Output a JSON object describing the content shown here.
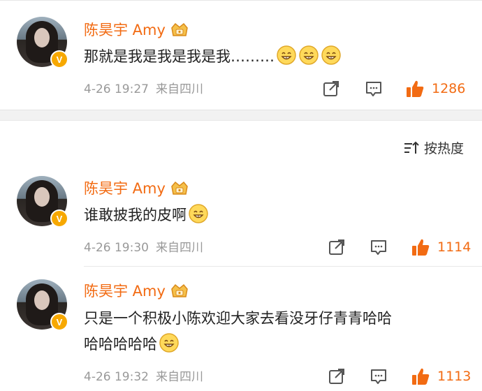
{
  "sort": {
    "label": "按热度"
  },
  "comments": [
    {
      "author": "陈昊宇 Amy",
      "text": "那就是我是我是我是我………",
      "emoji_count": 3,
      "date": "4-26 19:27",
      "location": "来自四川",
      "likes": "1286"
    },
    {
      "author": "陈昊宇 Amy",
      "text": "谁敢披我的皮啊",
      "emoji_count": 1,
      "date": "4-26 19:30",
      "location": "来自四川",
      "likes": "1114"
    },
    {
      "author": "陈昊宇 Amy",
      "text_line1": "只是一个积极小陈欢迎大家去看没牙仔青青哈哈",
      "text_line2": "哈哈哈哈哈",
      "emoji_count": 1,
      "date": "4-26 19:32",
      "location": "来自四川",
      "likes": "1113"
    }
  ],
  "icons": {
    "verified": "V",
    "crown": "crown-badge-icon",
    "emoji": "grin-emoji-icon",
    "share": "share-icon",
    "comment": "comment-icon",
    "like": "thumbs-up-icon",
    "sort": "sort-icon"
  },
  "colors": {
    "accent": "#f26b13",
    "meta": "#999999",
    "text": "#222222",
    "badge": "#f7a800"
  }
}
